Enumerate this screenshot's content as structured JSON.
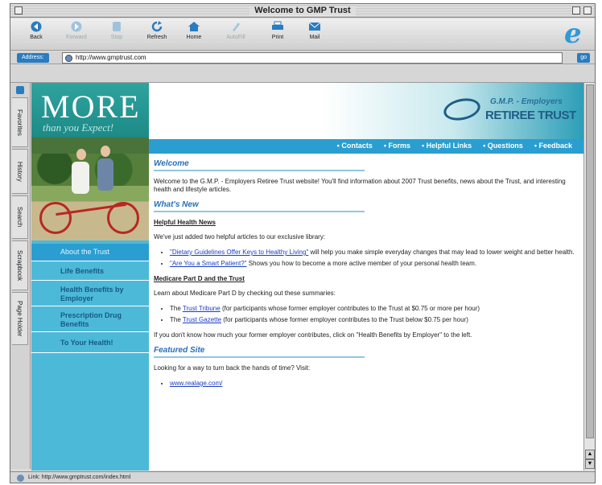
{
  "window": {
    "title": "Welcome to GMP Trust"
  },
  "toolbar": {
    "buttons": [
      {
        "label": "Back",
        "icon": "back-arrow-icon",
        "enabled": true
      },
      {
        "label": "Forward",
        "icon": "forward-arrow-icon",
        "enabled": false
      },
      {
        "label": "Stop",
        "icon": "stop-icon",
        "enabled": false
      },
      {
        "label": "Refresh",
        "icon": "refresh-icon",
        "enabled": true
      },
      {
        "label": "Home",
        "icon": "home-icon",
        "enabled": true
      },
      {
        "label": "AutoFill",
        "icon": "autofill-icon",
        "enabled": false
      },
      {
        "label": "Print",
        "icon": "print-icon",
        "enabled": true
      },
      {
        "label": "Mail",
        "icon": "mail-icon",
        "enabled": true
      }
    ]
  },
  "address": {
    "label": "Address:",
    "url": "http://www.gmptrust.com",
    "go": "go"
  },
  "sidetabs": [
    "Favorites",
    "History",
    "Search",
    "Scrapbook",
    "Page Holder"
  ],
  "site": {
    "more_word": "MORE",
    "more_sub": "than you Expect!",
    "logo_line1": "G.M.P. - Employers",
    "logo_line2": "RETIREE TRUST",
    "left_nav": [
      "About the Trust",
      "Life Benefits",
      "Health Benefits by Employer",
      "Prescription Drug Benefits",
      "To Your Health!"
    ],
    "top_nav": [
      "• Contacts",
      "• Forms",
      "• Helpful Links",
      "• Questions",
      "• Feedback"
    ]
  },
  "content": {
    "welcome_h": "Welcome",
    "welcome_p": "Welcome to the G.M.P. - Employers Retiree Trust website! You'll find information about 2007 Trust benefits, news about the Trust, and interesting health and lifestyle articles.",
    "whatsnew_h": "What's New",
    "health_h": "Helpful Health News",
    "health_p": "We've just added two helpful articles to our exclusive library:",
    "article1_link": "\"Dietary Guidelines Offer Keys to Healthy Living\"",
    "article1_text": " will help you make simple everyday changes that may lead to lower weight and better health.",
    "article2_link": "\"Are You a Smart Patient?\"",
    "article2_text": " Shows you how to become a more active member of your personal health team.",
    "medicare_h": "Medicare Part D and the Trust",
    "medicare_p": "Learn about Medicare Part D by checking out these summaries:",
    "the1": "The ",
    "tribune_link": "Trust Tribune",
    "tribune_text": " (for participants whose former employer contributes to the Trust at $0.75 or more per hour)",
    "the2": "The ",
    "gazette_link": "Trust Gazette",
    "gazette_text": " (for participants whose former employer contributes to the Trust below $0.75 per hour)",
    "employer_p": "If you don't know how much your former employer contributes, click on \"Health Benefits by Employer\" to the left.",
    "featured_h": "Featured Site",
    "featured_p": "Looking for a way to turn back the hands of time? Visit:",
    "featured_link": "www.realage.com/"
  },
  "status": {
    "text": "Link: http://www.gmptrust.com/index.html"
  }
}
